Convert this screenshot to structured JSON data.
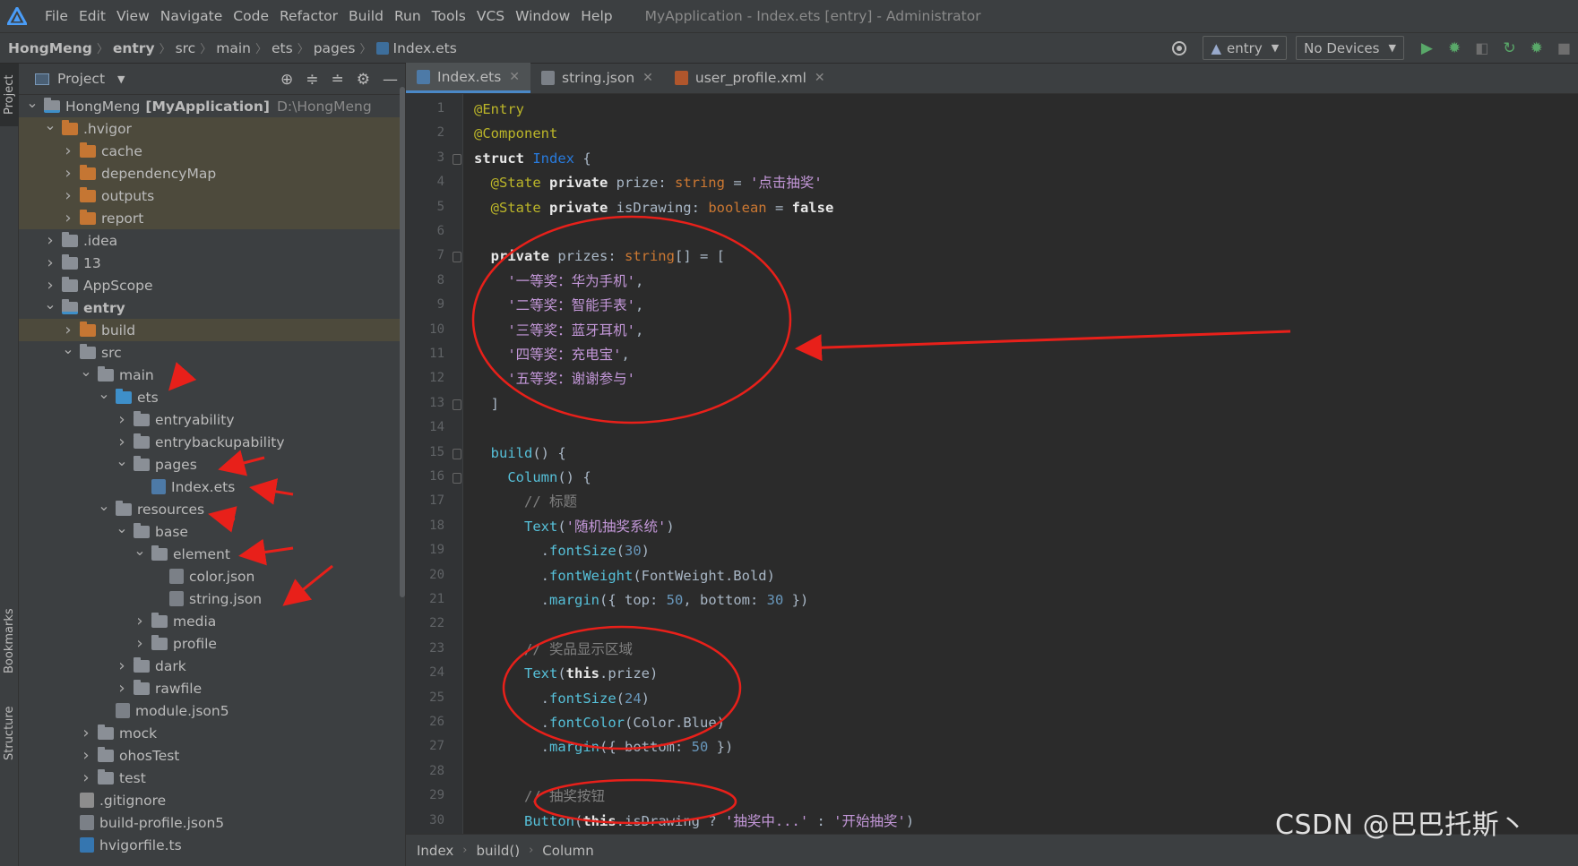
{
  "menubar": {
    "items": [
      "File",
      "Edit",
      "View",
      "Navigate",
      "Code",
      "Refactor",
      "Build",
      "Run",
      "Tools",
      "VCS",
      "Window",
      "Help"
    ],
    "window_title": "MyApplication - Index.ets [entry] - Administrator"
  },
  "breadcrumb": {
    "items": [
      "HongMeng",
      "entry",
      "src",
      "main",
      "ets",
      "pages",
      "Index.ets"
    ]
  },
  "toolbar": {
    "module_combo": "entry",
    "device_combo": "No Devices"
  },
  "side_tabs": {
    "project": "Project",
    "bookmarks": "Bookmarks",
    "structure": "Structure"
  },
  "project_panel": {
    "title": "Project",
    "tree": [
      {
        "label": "HongMeng",
        "bold_suffix": "[MyApplication]",
        "path": "D:\\HongMeng",
        "level": 0,
        "expanded": true,
        "icon": "folder-module"
      },
      {
        "label": ".hvigor",
        "level": 1,
        "expanded": true,
        "icon": "folder-orange",
        "highlight": true
      },
      {
        "label": "cache",
        "level": 2,
        "expanded": false,
        "icon": "folder-orange",
        "highlight": true
      },
      {
        "label": "dependencyMap",
        "level": 2,
        "expanded": false,
        "icon": "folder-orange",
        "highlight": true
      },
      {
        "label": "outputs",
        "level": 2,
        "expanded": false,
        "icon": "folder-orange",
        "highlight": true
      },
      {
        "label": "report",
        "level": 2,
        "expanded": false,
        "icon": "folder-orange",
        "highlight": true
      },
      {
        "label": ".idea",
        "level": 1,
        "expanded": false,
        "icon": "folder-gray"
      },
      {
        "label": "13",
        "level": 1,
        "expanded": false,
        "icon": "folder-gray"
      },
      {
        "label": "AppScope",
        "level": 1,
        "expanded": false,
        "icon": "folder-gray"
      },
      {
        "label": "entry",
        "level": 1,
        "expanded": true,
        "icon": "folder-module",
        "bold": true
      },
      {
        "label": "build",
        "level": 2,
        "expanded": false,
        "icon": "folder-orange",
        "highlight": true
      },
      {
        "label": "src",
        "level": 2,
        "expanded": true,
        "icon": "folder-gray"
      },
      {
        "label": "main",
        "level": 3,
        "expanded": true,
        "icon": "folder-gray"
      },
      {
        "label": "ets",
        "level": 4,
        "expanded": true,
        "icon": "folder-blue"
      },
      {
        "label": "entryability",
        "level": 5,
        "expanded": false,
        "icon": "folder-gray"
      },
      {
        "label": "entrybackupability",
        "level": 5,
        "expanded": false,
        "icon": "folder-gray"
      },
      {
        "label": "pages",
        "level": 5,
        "expanded": true,
        "icon": "folder-gray"
      },
      {
        "label": "Index.ets",
        "level": 6,
        "leaf": true,
        "icon": "file-ets"
      },
      {
        "label": "resources",
        "level": 4,
        "expanded": true,
        "icon": "folder-gray"
      },
      {
        "label": "base",
        "level": 5,
        "expanded": true,
        "icon": "folder-gray"
      },
      {
        "label": "element",
        "level": 6,
        "expanded": true,
        "icon": "folder-gray"
      },
      {
        "label": "color.json",
        "level": 7,
        "leaf": true,
        "icon": "file-json"
      },
      {
        "label": "string.json",
        "level": 7,
        "leaf": true,
        "icon": "file-json"
      },
      {
        "label": "media",
        "level": 6,
        "expanded": false,
        "icon": "folder-gray"
      },
      {
        "label": "profile",
        "level": 6,
        "expanded": false,
        "icon": "folder-gray"
      },
      {
        "label": "dark",
        "level": 5,
        "expanded": false,
        "icon": "folder-gray"
      },
      {
        "label": "rawfile",
        "level": 5,
        "expanded": false,
        "icon": "folder-gray"
      },
      {
        "label": "module.json5",
        "level": 4,
        "leaf": true,
        "icon": "file-json"
      },
      {
        "label": "mock",
        "level": 3,
        "expanded": false,
        "icon": "folder-gray"
      },
      {
        "label": "ohosTest",
        "level": 3,
        "expanded": false,
        "icon": "folder-gray"
      },
      {
        "label": "test",
        "level": 3,
        "expanded": false,
        "icon": "folder-gray"
      },
      {
        "label": ".gitignore",
        "level": 2,
        "leaf": true,
        "icon": "file-git"
      },
      {
        "label": "build-profile.json5",
        "level": 2,
        "leaf": true,
        "icon": "file-json"
      },
      {
        "label": "hvigorfile.ts",
        "level": 2,
        "leaf": true,
        "icon": "file-ts"
      }
    ]
  },
  "editor": {
    "tabs": [
      {
        "label": "Index.ets",
        "active": true,
        "icon": "file-ets"
      },
      {
        "label": "string.json",
        "active": false,
        "icon": "file-json"
      },
      {
        "label": "user_profile.xml",
        "active": false,
        "icon": "file-xml"
      }
    ],
    "fold_markers": [
      3,
      7,
      13,
      15,
      16
    ],
    "lines": [
      [
        [
          "an",
          "@Entry"
        ]
      ],
      [
        [
          "an",
          "@Component"
        ]
      ],
      [
        [
          "w",
          "struct "
        ],
        [
          "ty",
          "Index"
        ],
        [
          "pl",
          " {"
        ]
      ],
      [
        [
          "pl",
          "  "
        ],
        [
          "an",
          "@State "
        ],
        [
          "w",
          "private "
        ],
        [
          "pl",
          "prize: "
        ],
        [
          "kb",
          "string"
        ],
        [
          "pl",
          " = "
        ],
        [
          "s",
          "'点击抽奖'"
        ]
      ],
      [
        [
          "pl",
          "  "
        ],
        [
          "an",
          "@State "
        ],
        [
          "w",
          "private "
        ],
        [
          "pl",
          "isDrawing: "
        ],
        [
          "kb",
          "boolean"
        ],
        [
          "pl",
          " = "
        ],
        [
          "w",
          "false"
        ]
      ],
      [
        [
          "pl",
          ""
        ]
      ],
      [
        [
          "pl",
          "  "
        ],
        [
          "w",
          "private "
        ],
        [
          "pl",
          "prizes: "
        ],
        [
          "kb",
          "string"
        ],
        [
          "pl",
          "[] = ["
        ]
      ],
      [
        [
          "pl",
          "    "
        ],
        [
          "s",
          "'一等奖：华为手机'"
        ],
        [
          "pl",
          ","
        ]
      ],
      [
        [
          "pl",
          "    "
        ],
        [
          "s",
          "'二等奖：智能手表'"
        ],
        [
          "pl",
          ","
        ]
      ],
      [
        [
          "pl",
          "    "
        ],
        [
          "s",
          "'三等奖：蓝牙耳机'"
        ],
        [
          "pl",
          ","
        ]
      ],
      [
        [
          "pl",
          "    "
        ],
        [
          "s",
          "'四等奖：充电宝'"
        ],
        [
          "pl",
          ","
        ]
      ],
      [
        [
          "pl",
          "    "
        ],
        [
          "s",
          "'五等奖：谢谢参与'"
        ]
      ],
      [
        [
          "pl",
          "  ]"
        ]
      ],
      [
        [
          "pl",
          ""
        ]
      ],
      [
        [
          "pl",
          "  "
        ],
        [
          "fn",
          "build"
        ],
        [
          "pl",
          "() {"
        ]
      ],
      [
        [
          "pl",
          "    "
        ],
        [
          "fn",
          "Column"
        ],
        [
          "pl",
          "() {"
        ]
      ],
      [
        [
          "pl",
          "      "
        ],
        [
          "cm",
          "// 标题"
        ]
      ],
      [
        [
          "pl",
          "      "
        ],
        [
          "fn",
          "Text"
        ],
        [
          "pl",
          "("
        ],
        [
          "s",
          "'随机抽奖系统'"
        ],
        [
          "pl",
          ")"
        ]
      ],
      [
        [
          "pl",
          "        ."
        ],
        [
          "mth",
          "fontSize"
        ],
        [
          "pl",
          "("
        ],
        [
          "nu",
          "30"
        ],
        [
          "pl",
          ")"
        ]
      ],
      [
        [
          "pl",
          "        ."
        ],
        [
          "mth",
          "fontWeight"
        ],
        [
          "pl",
          "(FontWeight.Bold)"
        ]
      ],
      [
        [
          "pl",
          "        ."
        ],
        [
          "mth",
          "margin"
        ],
        [
          "pl",
          "({ top: "
        ],
        [
          "nu",
          "50"
        ],
        [
          "pl",
          ", bottom: "
        ],
        [
          "nu",
          "30"
        ],
        [
          "pl",
          " })"
        ]
      ],
      [
        [
          "pl",
          ""
        ]
      ],
      [
        [
          "pl",
          "      "
        ],
        [
          "cm",
          "// 奖品显示区域"
        ]
      ],
      [
        [
          "pl",
          "      "
        ],
        [
          "fn",
          "Text"
        ],
        [
          "pl",
          "("
        ],
        [
          "w",
          "this"
        ],
        [
          "pl",
          ".prize)"
        ]
      ],
      [
        [
          "pl",
          "        ."
        ],
        [
          "mth",
          "fontSize"
        ],
        [
          "pl",
          "("
        ],
        [
          "nu",
          "24"
        ],
        [
          "pl",
          ")"
        ]
      ],
      [
        [
          "pl",
          "        ."
        ],
        [
          "mth",
          "fontColor"
        ],
        [
          "pl",
          "(Color.Blue)"
        ]
      ],
      [
        [
          "pl",
          "        ."
        ],
        [
          "mth",
          "margin"
        ],
        [
          "pl",
          "({ bottom: "
        ],
        [
          "nu",
          "50"
        ],
        [
          "pl",
          " })"
        ]
      ],
      [
        [
          "pl",
          ""
        ]
      ],
      [
        [
          "pl",
          "      "
        ],
        [
          "cm",
          "// 抽奖按钮"
        ]
      ],
      [
        [
          "pl",
          "      "
        ],
        [
          "fn",
          "Button"
        ],
        [
          "pl",
          "("
        ],
        [
          "w",
          "this"
        ],
        [
          "pl",
          ".isDrawing ? "
        ],
        [
          "s",
          "'抽奖中...'"
        ],
        [
          "pl",
          " : "
        ],
        [
          "s",
          "'开始抽奖'"
        ],
        [
          "pl",
          ")"
        ]
      ]
    ],
    "footer_crumbs": [
      "Index",
      "build()",
      "Column"
    ]
  },
  "watermark": "CSDN @巴巴托斯丶",
  "colors": {
    "annotation_red": "#e8201a",
    "highlight_row": "#4d4a3c",
    "accent_tab": "#4a88c7"
  }
}
